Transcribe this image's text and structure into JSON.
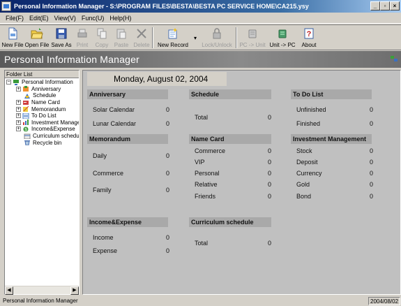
{
  "window": {
    "title": "Personal Information Manager - S:\\PROGRAM FILES\\BESTA\\BESTA PC SERVICE HOME\\CA215.ysy"
  },
  "menu": [
    "File(F)",
    "Edit(E)",
    "View(V)",
    "Func(U)",
    "Help(H)"
  ],
  "toolbar": {
    "new_file": "New File",
    "open_file": "Open File",
    "save_as": "Save As",
    "print": "Print",
    "copy": "Copy",
    "paste": "Paste",
    "delete": "Delete",
    "new_record": "New Record",
    "lock_unlock": "Lock/Unlock",
    "pc_to_unit": "PC -> Unit",
    "unit_to_pc": "Unit -> PC",
    "about": "About"
  },
  "header": {
    "title": "Personal Information Manager"
  },
  "folder": {
    "label": "Folder List",
    "root": "Personal Information",
    "items": [
      "Anniversary",
      "Schedule",
      "Name Card",
      "Memorandum",
      "To Do List",
      "Investment Management",
      "Income&Expense",
      "Curriculum schedule",
      "Recycle bin"
    ]
  },
  "date_display": "Monday, August 02, 2004",
  "sections": {
    "anniversary": {
      "title": "Anniversary",
      "rows": [
        [
          "Solar Calendar",
          "0"
        ],
        [
          "Lunar Calendar",
          "0"
        ]
      ]
    },
    "schedule": {
      "title": "Schedule",
      "rows": [
        [
          "Total",
          "0"
        ]
      ]
    },
    "todo": {
      "title": "To Do List",
      "rows": [
        [
          "Unfinished",
          "0"
        ],
        [
          "Finished",
          "0"
        ]
      ]
    },
    "memorandum": {
      "title": "Memorandum",
      "rows": [
        [
          "Daily",
          "0"
        ],
        [
          "Commerce",
          "0"
        ],
        [
          "Family",
          "0"
        ]
      ]
    },
    "namecard": {
      "title": "Name Card",
      "rows": [
        [
          "Commerce",
          "0"
        ],
        [
          "VIP",
          "0"
        ],
        [
          "Personal",
          "0"
        ],
        [
          "Relative",
          "0"
        ],
        [
          "Friends",
          "0"
        ]
      ]
    },
    "investment": {
      "title": "Investment Management",
      "rows": [
        [
          "Stock",
          "0"
        ],
        [
          "Deposit",
          "0"
        ],
        [
          "Currency",
          "0"
        ],
        [
          "Gold",
          "0"
        ],
        [
          "Bond",
          "0"
        ]
      ]
    },
    "income": {
      "title": "Income&Expense",
      "rows": [
        [
          "Income",
          "0"
        ],
        [
          "Expense",
          "0"
        ]
      ]
    },
    "curriculum": {
      "title": "Curriculum schedule",
      "rows": [
        [
          "Total",
          "0"
        ]
      ]
    }
  },
  "status": {
    "text": "Personal Information Manager",
    "date": "2004/08/02"
  },
  "colors": {
    "title_bar": "#0a246a",
    "header_band": "#6e6e6e",
    "card_header": "#a9a9a9",
    "panel_bg": "#c0c0c0"
  }
}
